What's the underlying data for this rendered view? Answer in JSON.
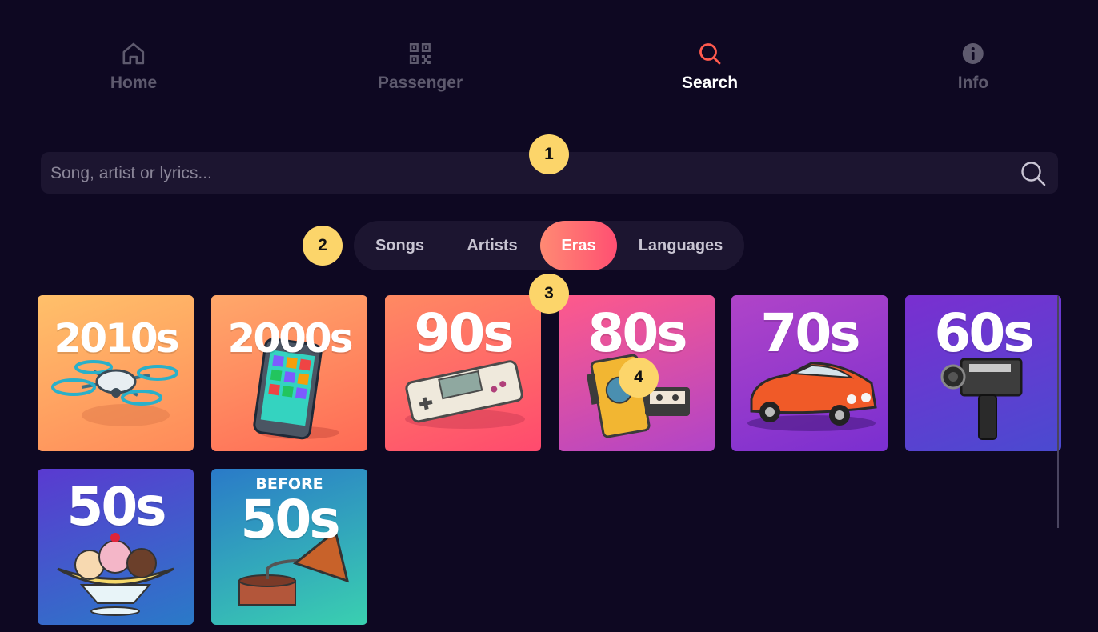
{
  "nav": {
    "items": [
      {
        "label": "Home",
        "icon": "home-icon"
      },
      {
        "label": "Passenger",
        "icon": "qr-code-icon"
      },
      {
        "label": "Search",
        "icon": "search-icon",
        "active": true
      },
      {
        "label": "Info",
        "icon": "info-icon"
      }
    ]
  },
  "search": {
    "placeholder": "Song, artist or lyrics...",
    "value": ""
  },
  "tabs": [
    {
      "label": "Songs"
    },
    {
      "label": "Artists"
    },
    {
      "label": "Eras",
      "active": true
    },
    {
      "label": "Languages"
    }
  ],
  "badges": [
    "1",
    "2",
    "3",
    "4"
  ],
  "eras": [
    {
      "pre": "",
      "label": "2010s",
      "art": "drone"
    },
    {
      "pre": "",
      "label": "2000s",
      "art": "smartphone"
    },
    {
      "pre": "",
      "label": "90s",
      "art": "game-console"
    },
    {
      "pre": "",
      "label": "80s",
      "art": "walkman-cassette"
    },
    {
      "pre": "",
      "label": "70s",
      "art": "muscle-car"
    },
    {
      "pre": "",
      "label": "60s",
      "art": "film-camera"
    },
    {
      "pre": "",
      "label": "50s",
      "art": "banana-split"
    },
    {
      "pre": "BEFORE",
      "label": "50s",
      "art": "gramophone"
    }
  ],
  "colors": {
    "background": "#0e0822",
    "accent": "#ff5a72",
    "badge": "#fcd56a",
    "nav_active_icon": "#ff5a4e",
    "nav_inactive": "#5e5a6e"
  }
}
